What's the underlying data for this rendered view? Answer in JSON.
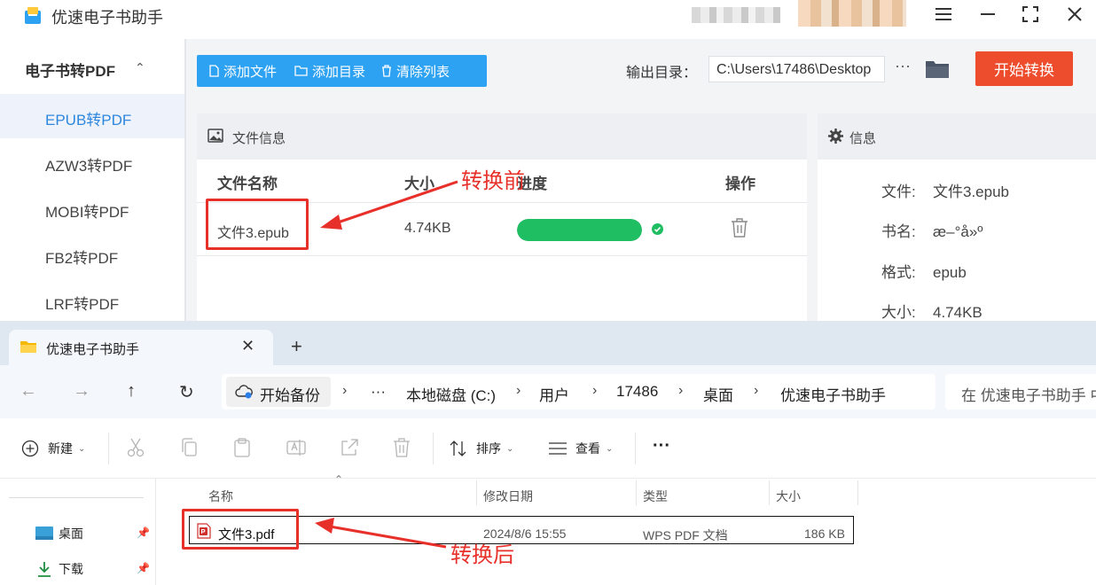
{
  "app": {
    "title": "优速电子书助手",
    "sidebar": {
      "group_title": "电子书转PDF",
      "items": [
        {
          "label": "EPUB转PDF",
          "active": true
        },
        {
          "label": "AZW3转PDF",
          "active": false
        },
        {
          "label": "MOBI转PDF",
          "active": false
        },
        {
          "label": "FB2转PDF",
          "active": false
        },
        {
          "label": "LRF转PDF",
          "active": false
        }
      ]
    },
    "toolbar": {
      "add_file": "添加文件",
      "add_folder": "添加目录",
      "clear_list": "清除列表",
      "output_label": "输出目录：",
      "output_path": "C:\\Users\\17486\\Desktop",
      "more": "···",
      "start": "开始转换"
    },
    "file_panel": {
      "title": "文件信息",
      "columns": {
        "name": "文件名称",
        "size": "大小",
        "progress": "进度",
        "action": "操作"
      },
      "rows": [
        {
          "name": "文件3.epub",
          "size": "4.74KB",
          "progress": 1.0,
          "status": "done"
        }
      ]
    },
    "info_panel": {
      "title": "信息",
      "rows": [
        {
          "key": "文件:",
          "value": "文件3.epub"
        },
        {
          "key": "书名:",
          "value": "æ–°å»º"
        },
        {
          "key": "格式:",
          "value": "epub"
        },
        {
          "key": "大小:",
          "value": "4.74KB"
        }
      ]
    }
  },
  "annotations": {
    "before": "转换前",
    "after": "转换后",
    "color": "#e8302a"
  },
  "explorer": {
    "tab_title": "优速电子书助手",
    "tab_close": "✕",
    "tab_new": "+",
    "nav": {
      "back": "←",
      "forward": "→",
      "up": "↑",
      "refresh": "↻"
    },
    "breadcrumbs": {
      "backup": "开始备份",
      "more": "···",
      "parts": [
        "本地磁盘 (C:)",
        "用户",
        "17486",
        "桌面",
        "优速电子书助手"
      ]
    },
    "search_placeholder": "在 优速电子书助手 中搜索",
    "commands": {
      "new": "新建",
      "sort": "排序",
      "view": "查看",
      "more": "···"
    },
    "nav_pane": [
      {
        "label": "桌面",
        "icon": "desktop-icon"
      },
      {
        "label": "下载",
        "icon": "download-icon"
      }
    ],
    "columns": {
      "name": "名称",
      "modified": "修改日期",
      "type": "类型",
      "size": "大小"
    },
    "files": [
      {
        "name": "文件3.pdf",
        "modified": "2024/8/6 15:55",
        "type": "WPS PDF 文档",
        "size": "186 KB"
      }
    ]
  }
}
